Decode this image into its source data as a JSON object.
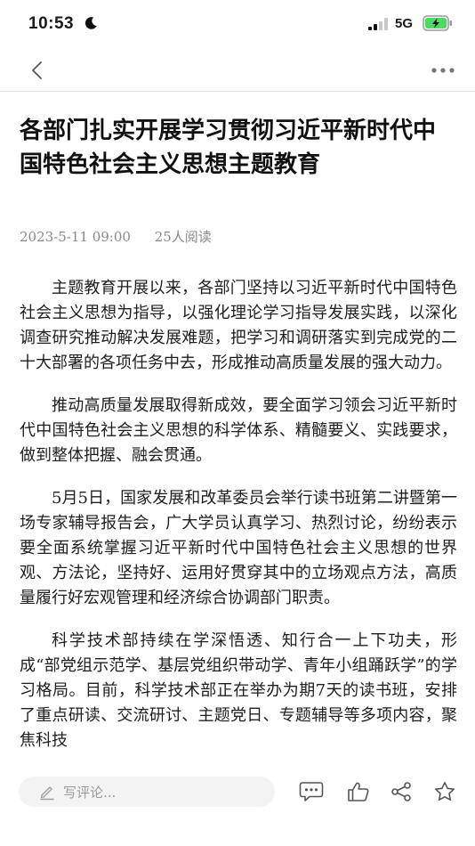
{
  "status_bar": {
    "time": "10:53",
    "network": "5G"
  },
  "article": {
    "title": "各部门扎实开展学习贯彻习近平新时代中国特色社会主义思想主题教育",
    "datetime": "2023-5-11  09:00",
    "read_count": "25人阅读",
    "paragraphs": [
      "主题教育开展以来，各部门坚持以习近平新时代中国特色社会主义思想为指导，以强化理论学习指导发展实践，以深化调查研究推动解决发展难题，把学习和调研落实到完成党的二十大部署的各项任务中去，形成推动高质量发展的强大动力。",
      "推动高质量发展取得新成效，要全面学习领会习近平新时代中国特色社会主义思想的科学体系、精髓要义、实践要求，做到整体把握、融会贯通。",
      "5月5日，国家发展和改革委员会举行读书班第二讲暨第一场专家辅导报告会，广大学员认真学习、热烈讨论，纷纷表示要全面系统掌握习近平新时代中国特色社会主义思想的世界观、方法论，坚持好、运用好贯穿其中的立场观点方法，高质量履行好宏观管理和经济综合协调部门职责。",
      "科学技术部持续在学深悟透、知行合一上下功夫，形成“部党组示范学、基层党组织带动学、青年小组踊跃学”的学习格局。目前，科学技术部正在举办为期7天的读书班，安排了重点研读、交流研讨、主题党日、专题辅导等多项内容，聚焦科技"
    ]
  },
  "bottom_bar": {
    "comment_placeholder": "写评论..."
  },
  "colors": {
    "battery_fill": "#4cd964",
    "meta_text": "#8a8a8a",
    "icon_gray": "#666666"
  },
  "icons": {
    "status": [
      "moon-icon",
      "signal-icon",
      "battery-charging-icon"
    ],
    "nav": [
      "back-chevron-icon",
      "more-dots-icon"
    ],
    "actions": [
      "pen-icon",
      "comment-icon",
      "like-icon",
      "share-icon",
      "favorite-star-icon"
    ]
  }
}
